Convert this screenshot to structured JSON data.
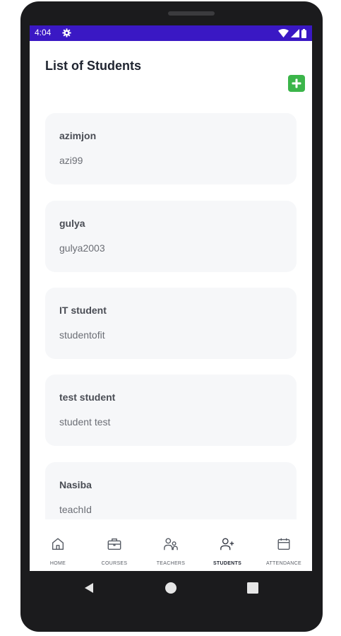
{
  "status_bar": {
    "time": "4:04"
  },
  "header": {
    "title": "List of Students"
  },
  "students": [
    {
      "name": "azimjon",
      "login": "azi99"
    },
    {
      "name": "gulya",
      "login": "gulya2003"
    },
    {
      "name": "IT student",
      "login": "studentofit"
    },
    {
      "name": "test student",
      "login": "student test"
    },
    {
      "name": "Nasiba",
      "login": "teachId"
    }
  ],
  "nav": [
    {
      "label": "HOME",
      "icon": "home-icon",
      "active": false
    },
    {
      "label": "COURSES",
      "icon": "briefcase-icon",
      "active": false
    },
    {
      "label": "TEACHERS",
      "icon": "users-icon",
      "active": false
    },
    {
      "label": "STUDENTS",
      "icon": "user-plus-icon",
      "active": true
    },
    {
      "label": "ATTENDANCE",
      "icon": "calendar-icon",
      "active": false
    }
  ],
  "colors": {
    "status_bar": "#3a18c4",
    "add_button": "#3bb54a",
    "card_background": "#f6f7f9"
  }
}
